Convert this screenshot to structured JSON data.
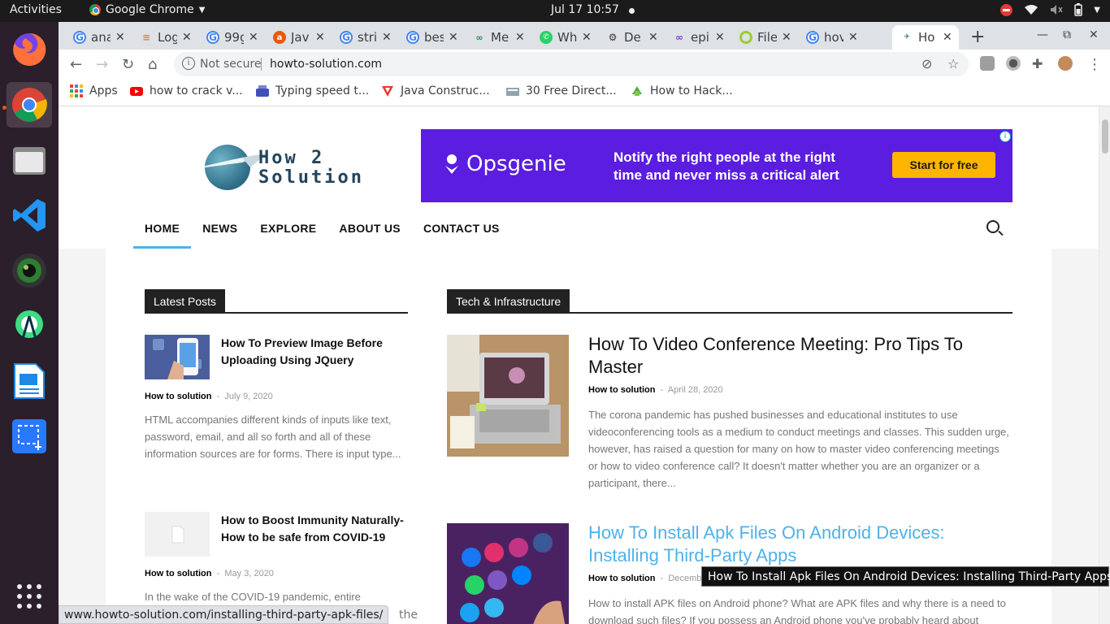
{
  "system": {
    "activities": "Activities",
    "app_menu": "Google Chrome",
    "clock": "Jul 17  10:57"
  },
  "tabs": [
    {
      "title": "ana",
      "icon": "google",
      "color": "#4285f4"
    },
    {
      "title": "Log",
      "icon": "stackoverflow",
      "color": "#f48024"
    },
    {
      "title": "99g",
      "icon": "google",
      "color": "#4285f4"
    },
    {
      "title": "Jav",
      "icon": "orange-circle",
      "color": "#e8590c"
    },
    {
      "title": "stri",
      "icon": "google",
      "color": "#4285f4"
    },
    {
      "title": "bes",
      "icon": "google",
      "color": "#4285f4"
    },
    {
      "title": "Me",
      "icon": "geeksforgeeks",
      "color": "#2f8d46"
    },
    {
      "title": "Wh",
      "icon": "whatsapp",
      "color": "#25d366"
    },
    {
      "title": "De",
      "icon": "gear",
      "color": "#333333"
    },
    {
      "title": "epi",
      "icon": "infinity",
      "color": "#7b3fe4"
    },
    {
      "title": "File",
      "icon": "lime-ring",
      "color": "#9acd32"
    },
    {
      "title": "hov",
      "icon": "google",
      "color": "#4285f4"
    },
    {
      "title": "Ho",
      "icon": "site",
      "color": "#2d6b86",
      "active": true
    }
  ],
  "toolbar": {
    "not_secure": "Not secure",
    "url": "howto-solution.com"
  },
  "bookmarks": [
    {
      "label": "Apps",
      "icon": "apps-grid"
    },
    {
      "label": "how to crack v...",
      "icon": "youtube"
    },
    {
      "label": "Typing speed t...",
      "icon": "typing"
    },
    {
      "label": "Java Construc...",
      "icon": "javatpoint"
    },
    {
      "label": "30 Free Direct...",
      "icon": "directory"
    },
    {
      "label": "How to Hack...",
      "icon": "android"
    }
  ],
  "site": {
    "logo_line1": "How 2",
    "logo_line2": "Solution",
    "ad": {
      "brand": "Opsgenie",
      "message": "Notify the right people at the right time and never miss a critical alert",
      "cta": "Start for free",
      "info": "i"
    },
    "nav": [
      "HOME",
      "NEWS",
      "EXPLORE",
      "ABOUT US",
      "CONTACT US"
    ]
  },
  "latest": {
    "heading": "Latest Posts",
    "posts": [
      {
        "title": "How To Preview Image Before Uploading Using JQuery",
        "author": "How to solution",
        "date": "July 9, 2020",
        "excerpt": "HTML accompanies different kinds of inputs like text, password, email, and all so forth and all of these information sources are for forms. There is input type..."
      },
      {
        "title": "How to Boost Immunity Naturally- How to be safe from COVID-19",
        "author": "How to solution",
        "date": "May 3, 2020",
        "excerpt": "In the wake of the COVID-19 pandemic, entire"
      }
    ]
  },
  "tech": {
    "heading": "Tech & Infrastructure",
    "posts": [
      {
        "title": "How To Video Conference Meeting: Pro Tips To Master",
        "author": "How to solution",
        "date": "April 28, 2020",
        "excerpt": "The corona pandemic has pushed businesses and educational institutes to use videoconferencing tools as a medium to conduct meetings and classes. This sudden urge, however, has raised a question for many on how to master video conferencing meetings or how to video conference call? It doesn't matter whether you are an organizer or a participant, there..."
      },
      {
        "title": "How To Install Apk Files On Android Devices: Installing Third-Party Apps",
        "author": "How to solution",
        "date": "Decemb",
        "excerpt": "How to install APK files on Android phone? What are APK files and why there is a need to download such files? If you possess an Android phone you've probably heard about"
      }
    ]
  },
  "tooltip": "How To Install Apk Files On Android Devices: Installing Third-Party Apps",
  "status_url": "www.howto-solution.com/installing-third-party-apk-files/",
  "status_url_tail": "the",
  "colors": {
    "accent": "#4db2ec",
    "ad_bg": "#5b1de0",
    "ad_cta": "#ffb400"
  }
}
